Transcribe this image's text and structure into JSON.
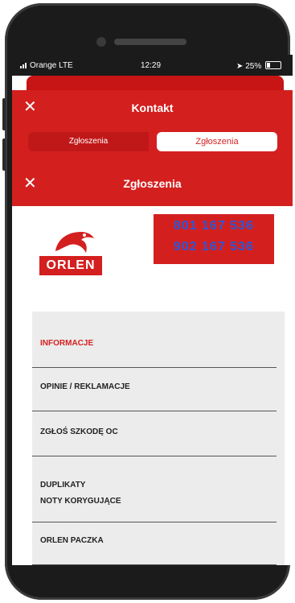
{
  "status_bar": {
    "carrier": "Orange  LTE",
    "time": "12:29",
    "battery": "25%"
  },
  "header": {
    "title": "Kontakt",
    "close_icon": "close-icon"
  },
  "segments": {
    "inactive_label": "Zgłoszenia",
    "active_label": "Zgłoszenia"
  },
  "subheader": {
    "title": "Zgłoszenia",
    "close_icon": "close-icon"
  },
  "brand": {
    "logo_text": "ORLEN",
    "phone_1": "801 167 536",
    "phone_2": "902 167 536"
  },
  "menu": {
    "items": [
      {
        "label": "INFORMACJE",
        "active": true
      },
      {
        "label": "OPINIE / REKLAMACJE",
        "active": false
      },
      {
        "label": "ZGŁOŚ SZKODĘ OC",
        "active": false
      },
      {
        "label_line1": "DUPLIKATY",
        "label_line2": "NOTY KORYGUJĄCE",
        "active": false
      },
      {
        "label": "ORLEN PACZKA",
        "active": false
      }
    ]
  },
  "colors": {
    "brand_red": "#d41f1f",
    "phone_blue": "#2a58d8",
    "menu_bg": "#ececec"
  }
}
